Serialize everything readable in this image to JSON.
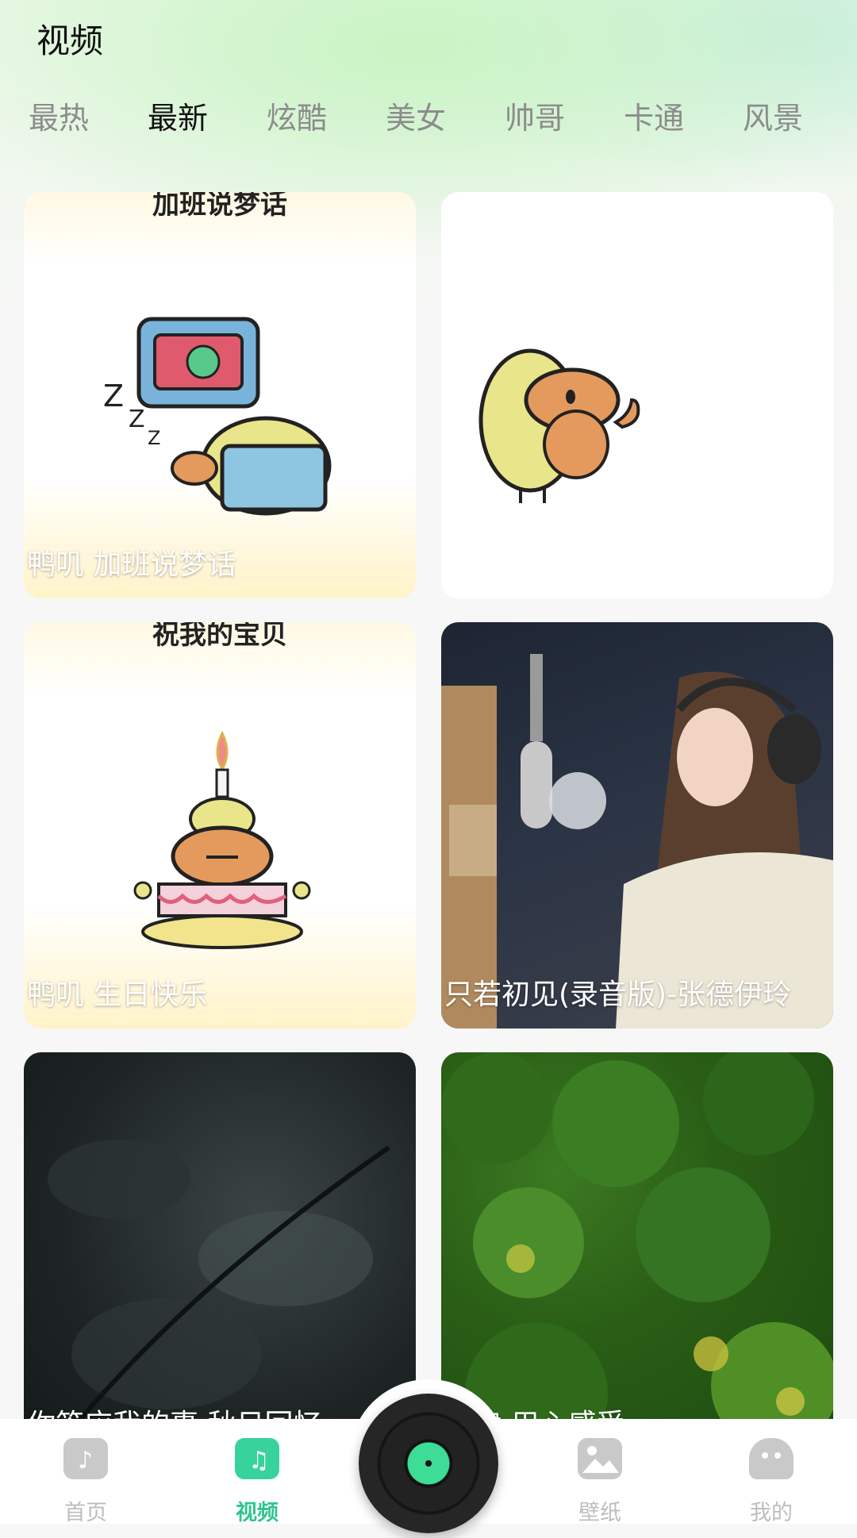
{
  "header": {
    "title": "视频"
  },
  "tabs": [
    "最热",
    "最新",
    "炫酷",
    "美女",
    "帅哥",
    "卡通",
    "风景"
  ],
  "active_tab": "最新",
  "cards": [
    {
      "top_text": "加班说梦话",
      "caption": "鸭叽 加班说梦话"
    },
    {
      "top_text": "",
      "caption": ""
    },
    {
      "top_text": "祝我的宝贝",
      "caption": "鸭叽 生日快乐"
    },
    {
      "top_text": "",
      "caption": "只若初见(录音版)-张德伊玲"
    },
    {
      "top_text": "",
      "caption": "你答应我的事 秋日回忆"
    },
    {
      "top_text": "",
      "caption": "旋律 用心感受"
    }
  ],
  "bottom_nav": [
    {
      "label": "首页",
      "icon": "music-note-icon"
    },
    {
      "label": "视频",
      "icon": "video-icon",
      "active": true
    },
    {
      "label": "",
      "icon": "vinyl-record-icon"
    },
    {
      "label": "壁纸",
      "icon": "image-icon"
    },
    {
      "label": "我的",
      "icon": "ghost-profile-icon"
    }
  ],
  "colors": {
    "accent": "#38d39c",
    "tab_inactive": "#8c8c8c",
    "tab_active": "#111111"
  }
}
